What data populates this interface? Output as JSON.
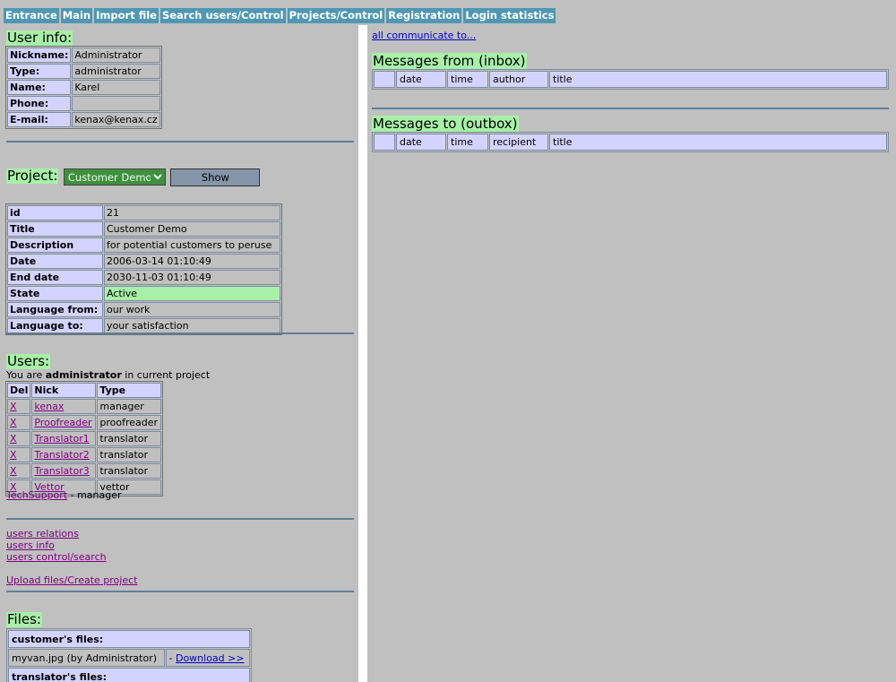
{
  "nav": [
    "Entrance",
    "Main",
    "Import file",
    "Search users/Control",
    "Projects/Control",
    "Registration",
    "Login statistics"
  ],
  "user_info": {
    "title": "User info:",
    "rows": [
      {
        "label": "Nickname:",
        "value": "Administrator"
      },
      {
        "label": "Type:",
        "value": "administrator"
      },
      {
        "label": "Name:",
        "value": "Karel"
      },
      {
        "label": "Phone:",
        "value": ""
      },
      {
        "label": "E-mail:",
        "value": "kenax@kenax.cz"
      }
    ]
  },
  "project": {
    "label": "Project:",
    "selected": "Customer Demo",
    "show_button": "Show",
    "rows": [
      {
        "label": "id",
        "value": "21"
      },
      {
        "label": "Title",
        "value": "Customer Demo"
      },
      {
        "label": "Description",
        "value": "for potential customers to peruse"
      },
      {
        "label": "Date",
        "value": "2006-03-14 01:10:49"
      },
      {
        "label": "End date",
        "value": "2030-11-03 01:10:49"
      },
      {
        "label": "State",
        "value": "Active"
      },
      {
        "label": "Language from:",
        "value": "our work"
      },
      {
        "label": "Language to:",
        "value": "your satisfaction"
      }
    ]
  },
  "users": {
    "title": "Users:",
    "intro_prefix": "You are ",
    "intro_role": "administrator",
    "intro_suffix": " in current project",
    "headers": [
      "Del",
      "Nick",
      "Type"
    ],
    "rows": [
      {
        "del": "X",
        "nick": "kenax",
        "type": "manager"
      },
      {
        "del": "X",
        "nick": "Proofreader",
        "type": "proofreader"
      },
      {
        "del": "X",
        "nick": "Translator1",
        "type": "translator"
      },
      {
        "del": "X",
        "nick": "Translator2",
        "type": "translator"
      },
      {
        "del": "X",
        "nick": "Translator3",
        "type": "translator"
      },
      {
        "del": "X",
        "nick": "Vettor",
        "type": "vettor"
      }
    ],
    "support_nick": "TechSupport",
    "support_suffix": " - manager"
  },
  "links": {
    "users_relations": "users relations",
    "users_info": "users info",
    "users_control": "users control/search",
    "upload": "Upload files/Create project"
  },
  "files": {
    "title": "Files:",
    "customer_label": "customer's files:",
    "file_name": "myvan.jpg (by Administrator)",
    "file_dash": "- ",
    "download": "Download >>",
    "translator_label": "translator's files:"
  },
  "messages": {
    "communicate": "all communicate to...",
    "inbox_title": "Messages from (inbox)",
    "inbox_headers": [
      "",
      "date",
      "time",
      "author",
      "title"
    ],
    "outbox_title": "Messages to (outbox)",
    "outbox_headers": [
      "",
      "date",
      "time",
      "recipient",
      "title"
    ]
  }
}
